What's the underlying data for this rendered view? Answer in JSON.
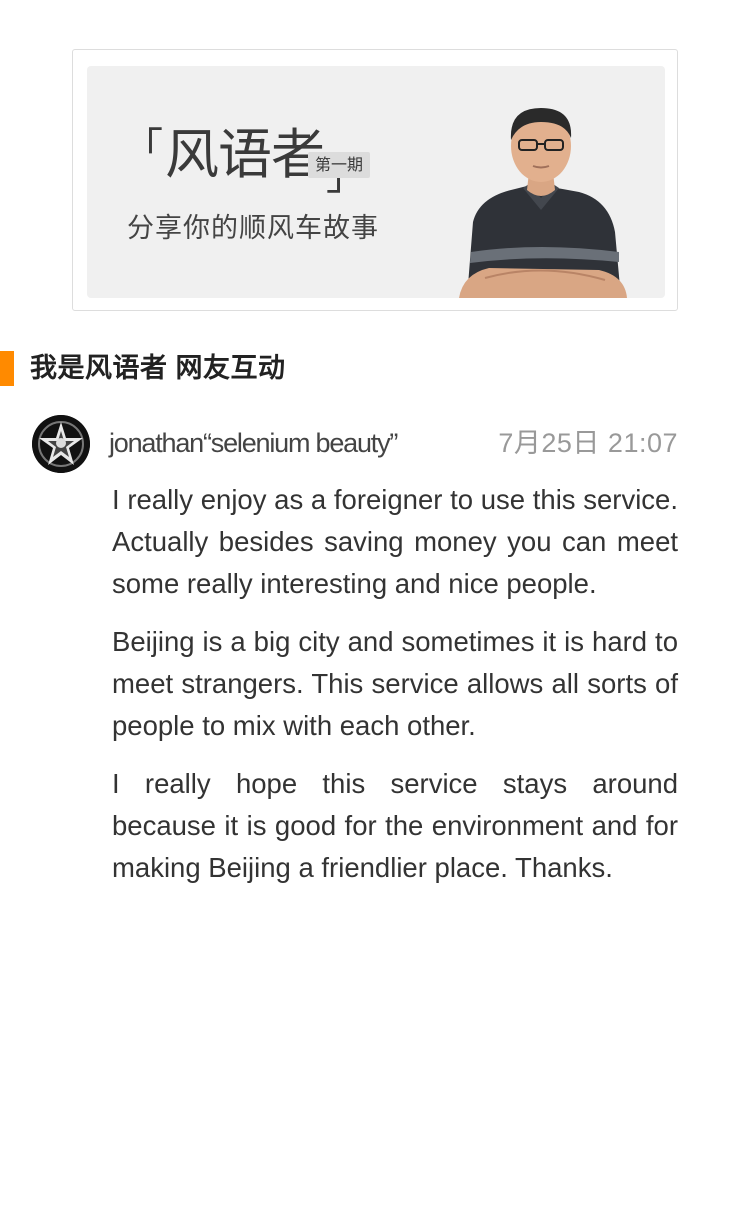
{
  "banner": {
    "title_bracket_left": "「",
    "title": "风语者",
    "title_bracket_right": "」",
    "issue": "第一期",
    "subtitle": "分享你的顺风车故事",
    "accent_color": "#ff8a00"
  },
  "section": {
    "title": "我是风语者 网友互动"
  },
  "comment": {
    "author": "jonathan“selenium beauty”",
    "time": "7月25日 21:07",
    "paragraphs": [
      "I really enjoy as a foreigner to use this service. Actually besides saving money you can meet some really interesting and nice people.",
      "Beijing is a big city and sometimes it is hard to meet strangers. This service allows all sorts of people to mix with each other.",
      "I really hope this service stays around because it is good for the environment and for making Beijing a friendlier place. Thanks."
    ]
  }
}
